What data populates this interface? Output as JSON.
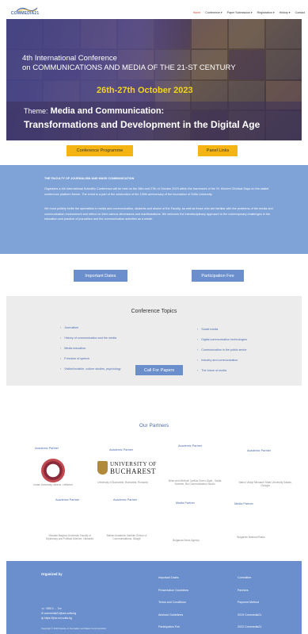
{
  "header": {
    "logo_text": "COMMEDIA21",
    "nav": [
      {
        "label": "Home",
        "active": true
      },
      {
        "label": "Conference ▾",
        "active": false
      },
      {
        "label": "Paper Submission ▾",
        "active": false
      },
      {
        "label": "Registration ▾",
        "active": false
      },
      {
        "label": "History ▾",
        "active": false
      },
      {
        "label": "Contact",
        "active": false
      }
    ]
  },
  "hero": {
    "conference_line1": "4th International Conference",
    "conference_line2": "on COMMUNICATIONS AND MEDIA OF THE 21-ST CENTURY",
    "dates": "26th-27th October 2023",
    "theme_label": "Theme:",
    "theme_title": "Media and Communication:",
    "theme_subtitle": "Transformations and Development in the Digital Age"
  },
  "buttons": {
    "conference_programme": "Conference Programme",
    "panel_links": "Panel Links",
    "important_dates": "Important Dates",
    "participation_fee": "Participation Fee",
    "call_for_papers": "Call For Papers"
  },
  "info": {
    "heading": "THE FACULTY OF JOURNALISM AND MASS COMMUNICATION",
    "paragraph1": "Organizes a 4th International Scientific Conference will be held on the 26th and 27th of October 2023 within the framework of the St. Kliment Ohridski Days on the stated conference platform theme. The event is a part of the celebration of the 135th anniversary of the foundation of Sofia University.",
    "paragraph2": "We most politely invite the specialists in media and communication, students and alumni of the Faculty, as well as those who are familiar with the problems of the media and communication environment and reflect on their various dimensions and manifestations. We welcome the interdisciplinary approach to the contemporary challenges in the education and practice of journalism and the communication activities as a whole."
  },
  "topics": {
    "title": "Conference Topics",
    "left": [
      "Journalism",
      "History of communication and the media",
      "Media education",
      "Freedom of speech",
      "Visible/invisible, culture studies, psychology"
    ],
    "right": [
      "Social media",
      "Digital communication technologies",
      "Communication in the public sector",
      "Industry and communication",
      "The future of media"
    ]
  },
  "partners": {
    "title": "Our Partners",
    "labels": [
      "Academic Partner",
      "Academic Partner",
      "Academic Partner",
      "Academic Partner",
      "Academic Partner",
      "Academic Partner",
      "Media Partner",
      "Media Partner"
    ],
    "names": [
      "Ionian University, Athens, Lefkimmi",
      "University of Bucharest, Bucharest, Romania",
      "Ilirian and Methodi Cyrillus Gorno-Dipid - Sadia Sozeme, Bul Communication Studio",
      "Nation Vitalyi Mihcaner State University Sakaki, Georgia",
      "Vitautas Magnus University Faculty of Diplomacy and Political Science, Lithuania",
      "Balkan Academic Institute School of Communications, Skopje",
      "Bulgarian News Agency",
      "Bulgarian National Radio"
    ],
    "unibuc_line1": "UNIVERSITY OF",
    "unibuc_line2": "BUCHAREST"
  },
  "footer": {
    "organized_by": "Organized by",
    "phone": "+359 2 ... 7xx",
    "email": "commedia21@uni-sofia.bg",
    "web": "https://fjmc.uni-sofia.bg",
    "links_col1": [
      "Important Dates",
      "Presentation Guidelines",
      "Terms and Conditions",
      "Abstract Guidelines",
      "Participation Fee"
    ],
    "links_col2": [
      "Committee",
      "Partners",
      "Payment Method",
      "2019 Commedia21",
      "2022 Commedia21"
    ],
    "copyright": "Copyright © 2023 Faculty of Journalism and Mass Communication"
  },
  "colors": {
    "accent_blue": "#6a8fcc",
    "orange": "#f4b413",
    "hero_yellow": "#f2d518",
    "active_nav": "#e0402a"
  }
}
